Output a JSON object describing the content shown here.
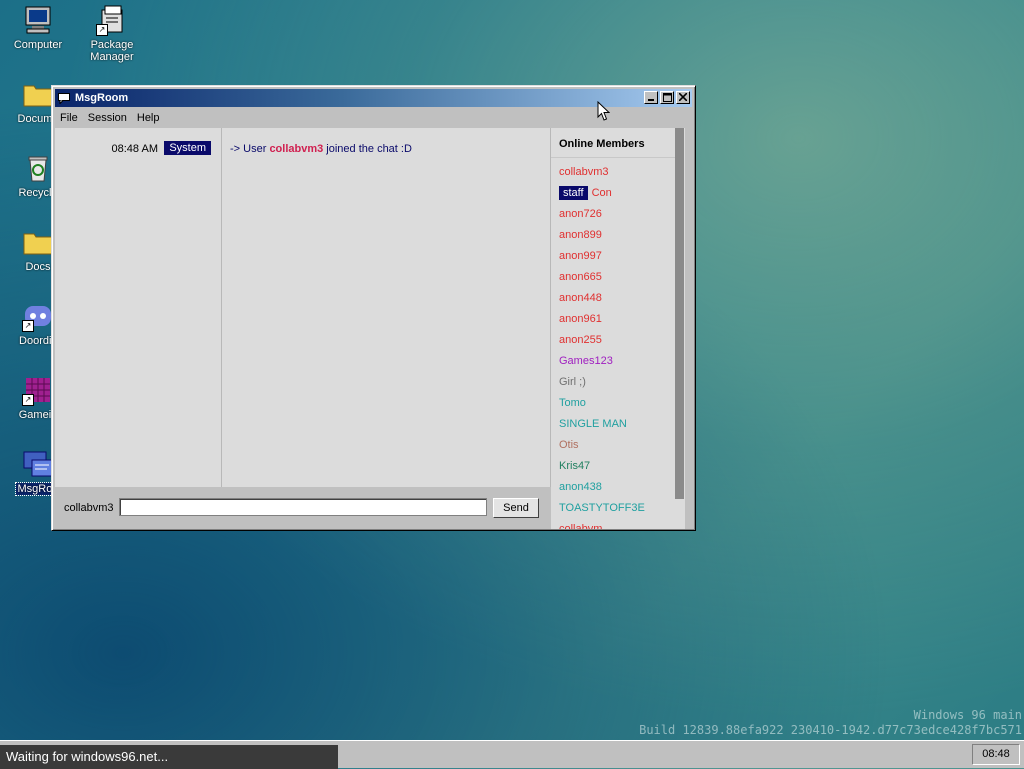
{
  "desktop": {
    "icons": [
      {
        "label": "Computer",
        "icon": "computer-icon"
      },
      {
        "label": "Package Manager",
        "icon": "package-manager-icon"
      },
      {
        "label": "Docume",
        "icon": "folder-icon"
      },
      {
        "label": "Recycle",
        "icon": "recycle-bin-icon"
      },
      {
        "label": "Docs",
        "icon": "folder-icon"
      },
      {
        "label": "Doordis",
        "icon": "discord-icon"
      },
      {
        "label": "Gamein",
        "icon": "game-icon"
      },
      {
        "label": "MsgRoo",
        "icon": "msgroom-icon"
      }
    ]
  },
  "window": {
    "title": "MsgRoom",
    "controls": {
      "minimize": "minimize-icon",
      "maximize": "maximize-icon",
      "close": "close-icon"
    },
    "menu": [
      "File",
      "Session",
      "Help"
    ]
  },
  "chat": {
    "messages": [
      {
        "time": "08:48 AM",
        "sender": "System",
        "text_prefix": "-> User ",
        "user": "collabvm3",
        "text_suffix": " joined the chat :D"
      }
    ]
  },
  "members": {
    "header": "Online Members",
    "list": [
      {
        "name": "collabvm3",
        "color": "#e03030"
      },
      {
        "badge": "staff",
        "name": "Con",
        "color": "#e03030"
      },
      {
        "name": "anon726",
        "color": "#e03030"
      },
      {
        "name": "anon899",
        "color": "#e03030"
      },
      {
        "name": "anon997",
        "color": "#e03030"
      },
      {
        "name": "anon665",
        "color": "#e03030"
      },
      {
        "name": "anon448",
        "color": "#e03030"
      },
      {
        "name": "anon961",
        "color": "#e03030"
      },
      {
        "name": "anon255",
        "color": "#e03030"
      },
      {
        "name": "Games123",
        "color": "#a020c0"
      },
      {
        "name": "Girl ;)",
        "color": "#707070"
      },
      {
        "name": "Tomo",
        "color": "#20a0a0"
      },
      {
        "name": "SINGLE MAN",
        "color": "#20a0a0"
      },
      {
        "name": "Otis",
        "color": "#b07060"
      },
      {
        "name": "Kris47",
        "color": "#208060"
      },
      {
        "name": "anon438",
        "color": "#20a0a0"
      },
      {
        "name": "TOASTYTOFF3E",
        "color": "#20a0a0"
      },
      {
        "name": "collabvm",
        "color": "#e03030"
      }
    ]
  },
  "input": {
    "username": "collabvm3",
    "value": "",
    "send_label": "Send"
  },
  "watermark": {
    "line1": "Windows 96 main",
    "line2": "Build 12839.88efa922 230410-1942.d77c73edce428f7bc571"
  },
  "taskbar": {
    "status": "Waiting for windows96.net...",
    "clock": "08:48"
  }
}
